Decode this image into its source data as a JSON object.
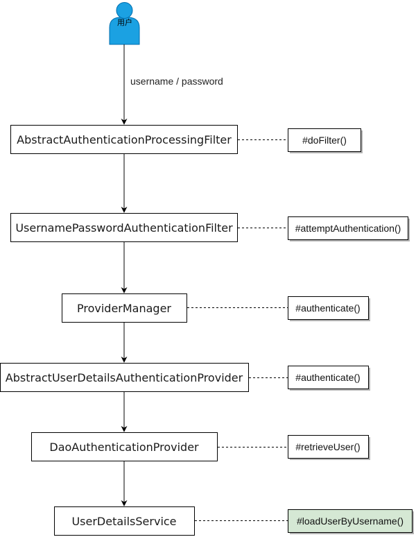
{
  "colors": {
    "actor_fill": "#1ba1e2",
    "actor_stroke": "#006eaf",
    "node_fill": "#ffffff",
    "node_stroke": "#000000",
    "note_fill": "#ffffff",
    "note_highlight_fill": "#d5e8d4",
    "shadow": "#b3b3b3",
    "edge": "#000000"
  },
  "actor": {
    "label": "用户"
  },
  "edge_label": "username / password",
  "nodes": [
    {
      "id": "abstract-authentication-processing-filter",
      "label": "AbstractAuthenticationProcessingFilter",
      "method": "#doFilter()",
      "highlight": false
    },
    {
      "id": "username-password-authentication-filter",
      "label": "UsernamePasswordAuthenticationFilter",
      "method": "#attemptAuthentication()",
      "highlight": false
    },
    {
      "id": "provider-manager",
      "label": "ProviderManager",
      "method": "#authenticate()",
      "highlight": false
    },
    {
      "id": "abstract-user-details-authentication-provider",
      "label": "AbstractUserDetailsAuthenticationProvider",
      "method": "#authenticate()",
      "highlight": false
    },
    {
      "id": "dao-authentication-provider",
      "label": "DaoAuthenticationProvider",
      "method": "#retrieveUser()",
      "highlight": false
    },
    {
      "id": "user-details-service",
      "label": "UserDetailsService",
      "method": "#loadUserByUsername()",
      "highlight": true
    }
  ]
}
